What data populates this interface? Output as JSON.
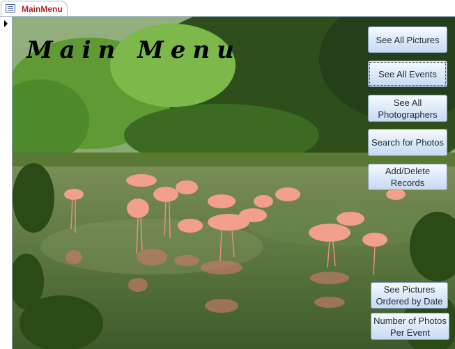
{
  "tab": {
    "label": "MainMenu",
    "icon": "form-icon"
  },
  "form": {
    "title": "Main Menu"
  },
  "buttons": {
    "see_all_pictures": "See All Pictures",
    "see_all_events": "See All Events",
    "see_all_photographers": "See All Photographers",
    "search_for_photos": "Search for Photos",
    "add_delete_records": "Add/Delete Records",
    "see_pictures_by_date": "See Pictures Ordered by Date",
    "photos_per_event": "Number of Photos Per Event"
  },
  "colors": {
    "tab_label": "#b0252a",
    "button_border": "#7f9db9",
    "accent": "#a9b8d1"
  }
}
